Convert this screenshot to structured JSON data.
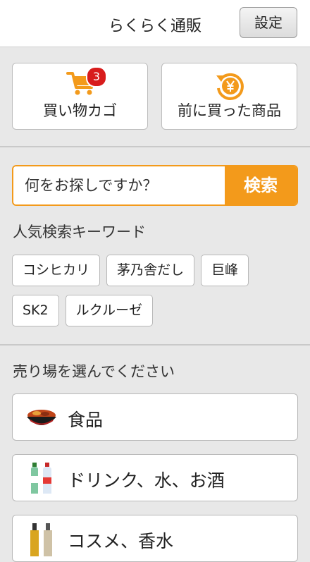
{
  "header": {
    "title": "らくらく通販",
    "settings_label": "設定"
  },
  "cart": {
    "label": "買い物カゴ",
    "count": "3"
  },
  "history": {
    "label": "前に買った商品"
  },
  "search": {
    "placeholder": "何をお探しですか？",
    "button_label": "検索"
  },
  "keywords": {
    "title": "人気検索キーワード",
    "items": [
      "コシヒカリ",
      "茅乃舎だし",
      "巨峰",
      "SK2",
      "ルクルーゼ"
    ]
  },
  "categories": {
    "title": "売り場を選んでください",
    "items": [
      {
        "label": "食品",
        "icon": "food-bowl-icon"
      },
      {
        "label": "ドリンク、水、お酒",
        "icon": "bottles-icon"
      },
      {
        "label": "コスメ、香水",
        "icon": "cosmetics-icon"
      }
    ]
  },
  "colors": {
    "accent": "#f39a1b",
    "badge": "#d81c1c",
    "background": "#e8e8e8"
  }
}
